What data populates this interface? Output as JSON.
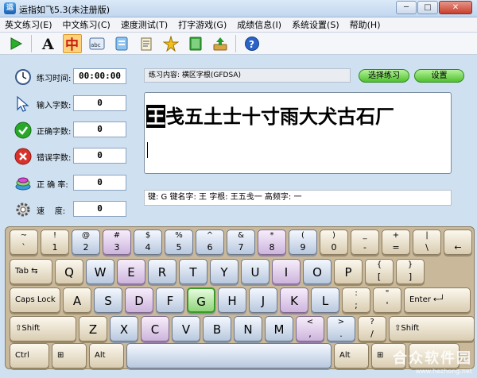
{
  "window": {
    "title": "运指如飞5.3(未注册版)",
    "icon": "app-icon",
    "minimize": "─",
    "maximize": "□",
    "close": "✕"
  },
  "menu": [
    "英文练习(E)",
    "中文练习(C)",
    "速度测试(T)",
    "打字游戏(G)",
    "成绩信息(I)",
    "系统设置(S)",
    "帮助(H)"
  ],
  "toolbar": {
    "items": [
      "play-icon",
      "english-a-icon",
      "chinese-zhong-icon",
      "abc-icon",
      "document-icon",
      "script-icon",
      "game-icon",
      "book-icon",
      "install-icon",
      "help-icon"
    ],
    "active": "chinese-zhong-icon"
  },
  "stats": {
    "time_label": "练习时间:",
    "time_value": "00:00:00",
    "input_label": "输入字数:",
    "input_value": "0",
    "correct_label": "正确字数:",
    "correct_value": "0",
    "wrong_label": "错误字数:",
    "wrong_value": "0",
    "accuracy_label": "正 确 率:",
    "accuracy_value": "0",
    "speed_label": "速    度:",
    "speed_value": "0"
  },
  "practice": {
    "content_label": "练习内容: 横区字根(GFDSA)",
    "select_button": "选择练习",
    "settings_button": "设置",
    "current_char": "王",
    "remaining_text": "戋五土士十寸雨大犬古石厂",
    "hint": "键: G   键名字: 王 字根: 王五戋一  高频字: 一"
  },
  "keyboard": {
    "row1": [
      {
        "top": "~",
        "bot": "`",
        "style": "beige"
      },
      {
        "top": "!",
        "bot": "1",
        "style": "beige"
      },
      {
        "top": "@",
        "bot": "2",
        "style": "blue"
      },
      {
        "top": "#",
        "bot": "3",
        "style": "purple"
      },
      {
        "top": "$",
        "bot": "4",
        "style": "blue"
      },
      {
        "top": "%",
        "bot": "5",
        "style": "blue"
      },
      {
        "top": "^",
        "bot": "6",
        "style": "blue"
      },
      {
        "top": "&",
        "bot": "7",
        "style": "blue"
      },
      {
        "top": "*",
        "bot": "8",
        "style": "purple"
      },
      {
        "top": "(",
        "bot": "9",
        "style": "blue"
      },
      {
        "top": ")",
        "bot": "0",
        "style": "beige"
      },
      {
        "top": "_",
        "bot": "-",
        "style": "beige"
      },
      {
        "top": "+",
        "bot": "=",
        "style": "beige"
      },
      {
        "top": "|",
        "bot": "\\",
        "style": "beige"
      },
      {
        "top": "",
        "bot": "←",
        "style": "beige"
      }
    ],
    "row2": [
      {
        "label": "Tab ⇆",
        "style": "beige"
      },
      {
        "main": "Q",
        "style": "beige"
      },
      {
        "main": "W",
        "style": "blue"
      },
      {
        "main": "E",
        "style": "purple"
      },
      {
        "main": "R",
        "style": "blue"
      },
      {
        "main": "T",
        "style": "blue"
      },
      {
        "main": "Y",
        "style": "blue"
      },
      {
        "main": "U",
        "style": "blue"
      },
      {
        "main": "I",
        "style": "purple"
      },
      {
        "main": "O",
        "style": "blue"
      },
      {
        "main": "P",
        "style": "beige"
      },
      {
        "top": "{",
        "bot": "[",
        "style": "beige"
      },
      {
        "top": "}",
        "bot": "]",
        "style": "beige"
      }
    ],
    "row3": [
      {
        "label": "Caps Lock",
        "style": "beige"
      },
      {
        "main": "A",
        "style": "beige"
      },
      {
        "main": "S",
        "style": "blue"
      },
      {
        "main": "D",
        "style": "purple"
      },
      {
        "main": "F",
        "style": "blue"
      },
      {
        "main": "G",
        "style": "green"
      },
      {
        "main": "H",
        "style": "blue"
      },
      {
        "main": "J",
        "style": "blue"
      },
      {
        "main": "K",
        "style": "purple"
      },
      {
        "main": "L",
        "style": "blue"
      },
      {
        "top": ":",
        "bot": ";",
        "style": "beige"
      },
      {
        "top": "\"",
        "bot": "'",
        "style": "beige"
      },
      {
        "label": "Enter ←┘",
        "style": "beige"
      }
    ],
    "row4": [
      {
        "label": "⇧Shift",
        "style": "beige"
      },
      {
        "main": "Z",
        "style": "beige"
      },
      {
        "main": "X",
        "style": "blue"
      },
      {
        "main": "C",
        "style": "purple"
      },
      {
        "main": "V",
        "style": "blue"
      },
      {
        "main": "B",
        "style": "blue"
      },
      {
        "main": "N",
        "style": "blue"
      },
      {
        "main": "M",
        "style": "blue"
      },
      {
        "top": "<",
        "bot": ",",
        "style": "purple"
      },
      {
        "top": ">",
        "bot": ".",
        "style": "blue"
      },
      {
        "top": "?",
        "bot": "/",
        "style": "beige"
      },
      {
        "label": "⇧Shift",
        "style": "beige"
      }
    ],
    "row5": [
      {
        "label": "Ctrl",
        "style": "beige"
      },
      {
        "label": "⊞",
        "style": "beige"
      },
      {
        "label": "Alt",
        "style": "beige"
      },
      {
        "label": "",
        "style": "blue"
      },
      {
        "label": "Alt",
        "style": "beige"
      },
      {
        "label": "⊞",
        "style": "beige"
      },
      {
        "label": "",
        "style": "beige"
      }
    ]
  },
  "watermark": {
    "main": "合众软件园",
    "sub": "www.hezhong.net"
  },
  "colors": {
    "accent_green": "#4fc22d",
    "key_purple": "#cdb4dc",
    "key_blue": "#b8c8de",
    "key_beige": "#d9ccb1",
    "highlight": "#8fd47a"
  }
}
